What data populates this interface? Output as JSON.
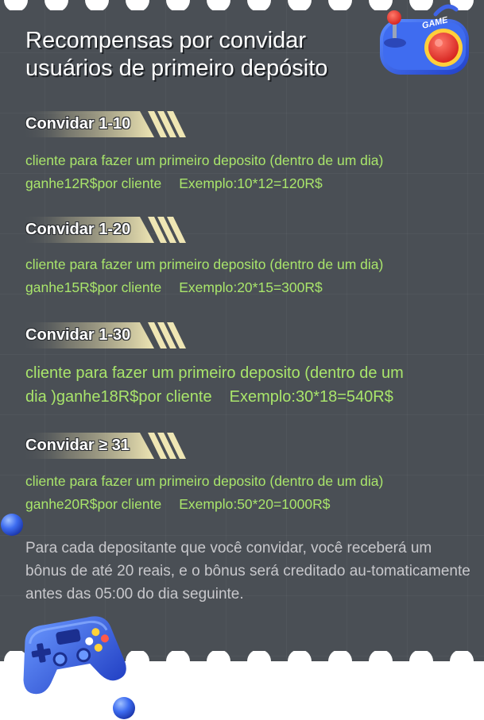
{
  "title": "Recompensas por convidar usuários de primeiro depósito",
  "logo": {
    "text": "GAME"
  },
  "sections": [
    {
      "tag": "Convidar 1-10",
      "line1": "cliente para fazer um primeiro deposito (dentro de um dia)",
      "line2_reward": "ganhe12R$por cliente",
      "line2_example": "Exemplo:10*12=120R$"
    },
    {
      "tag": "Convidar 1-20",
      "line1": "cliente para fazer um primeiro deposito (dentro de um dia)",
      "line2_reward": "ganhe15R$por cliente",
      "line2_example": "Exemplo:20*15=300R$"
    },
    {
      "tag": "Convidar 1-30",
      "line1": "cliente para fazer um primeiro deposito (dentro de um",
      "line2_reward": "dia )ganhe18R$por cliente",
      "line2_example": "Exemplo:30*18=540R$"
    },
    {
      "tag": "Convidar ≥ 31",
      "line1": "cliente para fazer um primeiro deposito (dentro de um dia)",
      "line2_reward": "ganhe20R$por cliente",
      "line2_example": "Exemplo:50*20=1000R$"
    }
  ],
  "note": "Para cada depositante que você convidar, você receberá um bônus de até 20 reais, e o bônus será creditado au-tomaticamente antes das 05:00 do dia seguinte.",
  "colors": {
    "panel": "#4a4f55",
    "highlight_text": "#a9e56b",
    "note_text": "#c8c8cc",
    "tag_gold": "#efe6b4",
    "accent_blue": "#3d6cf0"
  },
  "icons": [
    "arcade-joystick-icon",
    "gamepad-icon",
    "blue-sphere-icon"
  ]
}
